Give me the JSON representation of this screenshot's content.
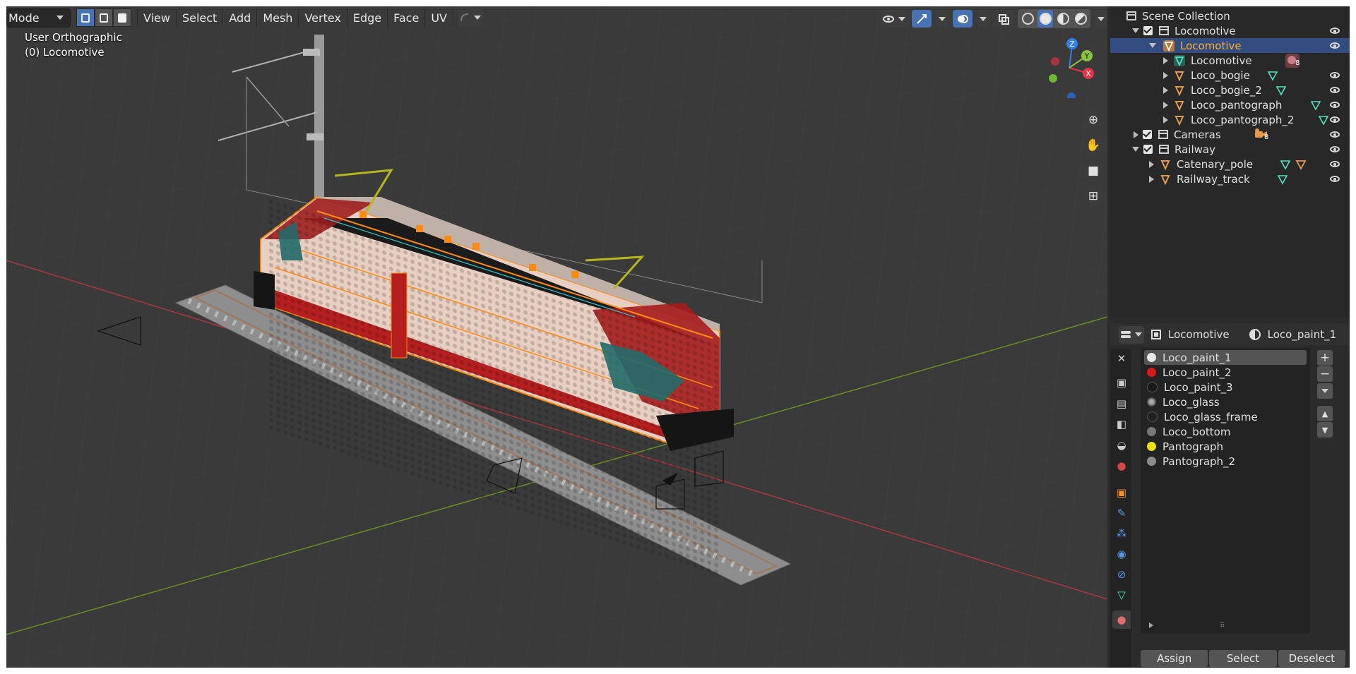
{
  "header": {
    "mode_label": "Mode",
    "menus": [
      "View",
      "Select",
      "Add",
      "Mesh",
      "Vertex",
      "Edge",
      "Face",
      "UV"
    ]
  },
  "viewport": {
    "view_name": "User Orthographic",
    "object_info": "(0) Locomotive",
    "axis_labels": {
      "x": "X",
      "y": "Y",
      "z": "Z"
    }
  },
  "outliner": {
    "root": "Scene Collection",
    "rows": [
      {
        "label": "Locomotive",
        "type": "collection"
      },
      {
        "label": "Locomotive",
        "type": "object",
        "selected": true
      },
      {
        "label": "Locomotive",
        "type": "mesh-data",
        "badge": "8"
      },
      {
        "label": "Loco_bogie",
        "type": "object"
      },
      {
        "label": "Loco_bogie_2",
        "type": "object"
      },
      {
        "label": "Loco_pantograph",
        "type": "object"
      },
      {
        "label": "Loco_pantograph_2",
        "type": "object"
      },
      {
        "label": "Cameras",
        "type": "collection",
        "badge": "8"
      },
      {
        "label": "Railway",
        "type": "collection"
      },
      {
        "label": "Catenary_pole",
        "type": "object"
      },
      {
        "label": "Railway_track",
        "type": "object"
      }
    ]
  },
  "properties": {
    "object_name": "Locomotive",
    "material_name": "Loco_paint_1",
    "materials": [
      {
        "name": "Loco_paint_1",
        "color": "#e8e8e8"
      },
      {
        "name": "Loco_paint_2",
        "color": "#d41c1c"
      },
      {
        "name": "Loco_paint_3",
        "color": "#1a1a1a"
      },
      {
        "name": "Loco_glass",
        "color": "#8a8a8a"
      },
      {
        "name": "Loco_glass_frame",
        "color": "#202020"
      },
      {
        "name": "Loco_bottom",
        "color": "#777777"
      },
      {
        "name": "Pantograph",
        "color": "#e8e400"
      },
      {
        "name": "Pantograph_2",
        "color": "#8c8c8c"
      }
    ],
    "buttons": {
      "assign": "Assign",
      "select": "Select",
      "deselect": "Deselect"
    }
  },
  "colors": {
    "accent": "#4772b3",
    "selected_row": "#334d80",
    "active_text": "#ffaf29",
    "edge_orange": "#ff8a10"
  }
}
